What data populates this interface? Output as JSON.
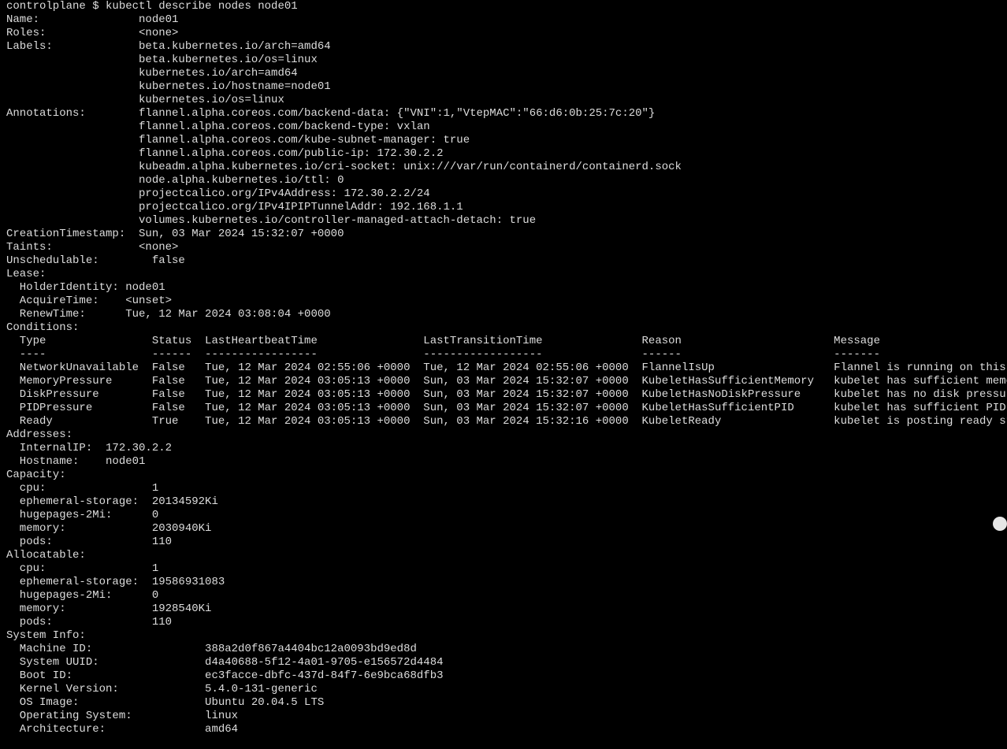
{
  "prompt": "controlplane $",
  "command": "kubectl describe nodes node01",
  "node": {
    "name": "node01",
    "roles": "<none>",
    "labels": [
      "beta.kubernetes.io/arch=amd64",
      "beta.kubernetes.io/os=linux",
      "kubernetes.io/arch=amd64",
      "kubernetes.io/hostname=node01",
      "kubernetes.io/os=linux"
    ],
    "annotations": [
      "flannel.alpha.coreos.com/backend-data: {\"VNI\":1,\"VtepMAC\":\"66:d6:0b:25:7c:20\"}",
      "flannel.alpha.coreos.com/backend-type: vxlan",
      "flannel.alpha.coreos.com/kube-subnet-manager: true",
      "flannel.alpha.coreos.com/public-ip: 172.30.2.2",
      "kubeadm.alpha.kubernetes.io/cri-socket: unix:///var/run/containerd/containerd.sock",
      "node.alpha.kubernetes.io/ttl: 0",
      "projectcalico.org/IPv4Address: 172.30.2.2/24",
      "projectcalico.org/IPv4IPIPTunnelAddr: 192.168.1.1",
      "volumes.kubernetes.io/controller-managed-attach-detach: true"
    ],
    "creation_timestamp": "Sun, 03 Mar 2024 15:32:07 +0000",
    "taints": "<none>",
    "unschedulable": "false",
    "lease": {
      "holder_identity": "node01",
      "acquire_time": "<unset>",
      "renew_time": "Tue, 12 Mar 2024 03:08:04 +0000"
    },
    "conditions_header": {
      "type": "Type",
      "status": "Status",
      "last_heartbeat": "LastHeartbeatTime",
      "last_transition": "LastTransitionTime",
      "reason": "Reason",
      "message": "Message"
    },
    "conditions": [
      {
        "type": "NetworkUnavailable",
        "status": "False",
        "hb": "Tue, 12 Mar 2024 02:55:06 +0000",
        "tr": "Tue, 12 Mar 2024 02:55:06 +0000",
        "reason": "FlannelIsUp",
        "msg": "Flannel is running on this node"
      },
      {
        "type": "MemoryPressure",
        "status": "False",
        "hb": "Tue, 12 Mar 2024 03:05:13 +0000",
        "tr": "Sun, 03 Mar 2024 15:32:07 +0000",
        "reason": "KubeletHasSufficientMemory",
        "msg": "kubelet has sufficient memory available"
      },
      {
        "type": "DiskPressure",
        "status": "False",
        "hb": "Tue, 12 Mar 2024 03:05:13 +0000",
        "tr": "Sun, 03 Mar 2024 15:32:07 +0000",
        "reason": "KubeletHasNoDiskPressure",
        "msg": "kubelet has no disk pressure"
      },
      {
        "type": "PIDPressure",
        "status": "False",
        "hb": "Tue, 12 Mar 2024 03:05:13 +0000",
        "tr": "Sun, 03 Mar 2024 15:32:07 +0000",
        "reason": "KubeletHasSufficientPID",
        "msg": "kubelet has sufficient PID available"
      },
      {
        "type": "Ready",
        "status": "True",
        "hb": "Tue, 12 Mar 2024 03:05:13 +0000",
        "tr": "Sun, 03 Mar 2024 15:32:16 +0000",
        "reason": "KubeletReady",
        "msg": "kubelet is posting ready status. AppArmor enabled"
      }
    ],
    "addresses": {
      "internal_ip": "172.30.2.2",
      "hostname": "node01"
    },
    "capacity": {
      "cpu": "1",
      "ephemeral_storage": "20134592Ki",
      "hugepages_2mi": "0",
      "memory": "2030940Ki",
      "pods": "110"
    },
    "allocatable": {
      "cpu": "1",
      "ephemeral_storage": "19586931083",
      "hugepages_2mi": "0",
      "memory": "1928540Ki",
      "pods": "110"
    },
    "system_info": {
      "machine_id": "388a2d0f867a4404bc12a0093bd9ed8d",
      "system_uuid": "d4a40688-5f12-4a01-9705-e156572d4484",
      "boot_id": "ec3facce-dbfc-437d-84f7-6e9bca68dfb3",
      "kernel_version": "5.4.0-131-generic",
      "os_image": "Ubuntu 20.04.5 LTS",
      "operating_system": "linux",
      "architecture": "amd64"
    }
  }
}
